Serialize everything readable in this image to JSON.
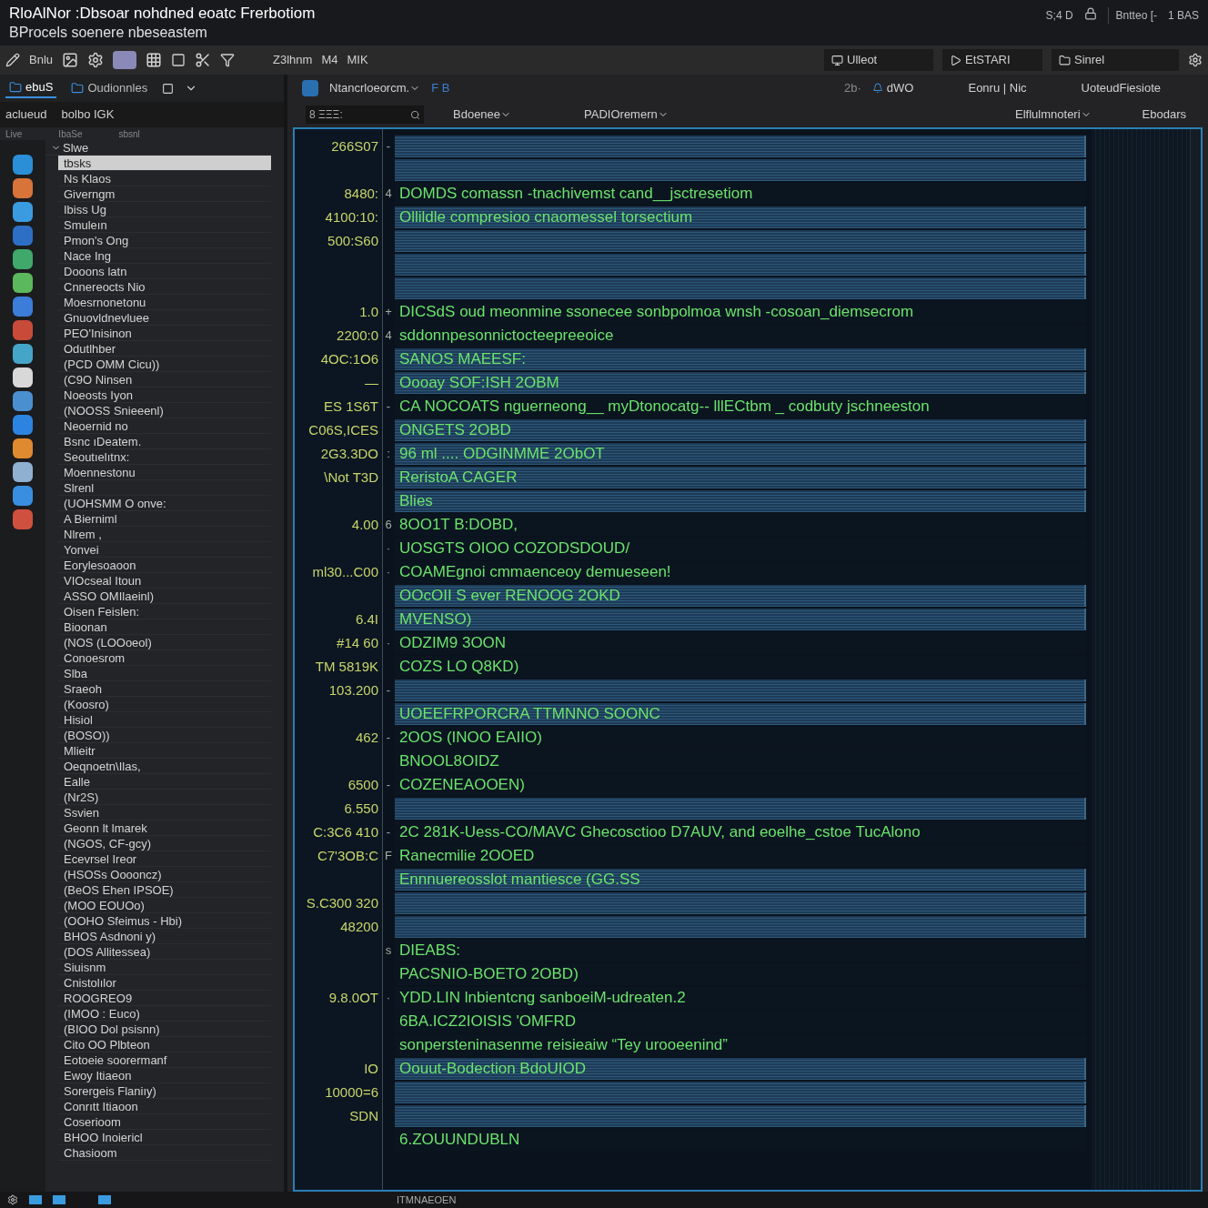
{
  "window": {
    "title": "RloAlNor :Dbsoar nohdned eoatc Frerbotiom",
    "subtitle": "BProcels soenere nbeseastem",
    "status": [
      "S;4 D",
      "Bntteo [-",
      "1 BAS"
    ]
  },
  "toolbar": {
    "labels": [
      "Bnlu",
      "Z3lhnm",
      "M4",
      "MIK"
    ],
    "right": [
      "Ulleot",
      "EtSTARI",
      "Sinrel"
    ]
  },
  "sidebar": {
    "tabs": [
      {
        "label": "ebuS",
        "selected": true
      },
      {
        "label": "Oudionnles",
        "selected": false
      }
    ],
    "filters": [
      "aclueud",
      "bolbo IGK"
    ],
    "columns": [
      "Live",
      "IbaSe",
      "sbsnl"
    ],
    "tree": [
      {
        "label": "Slwe",
        "expanded": true,
        "selected": false,
        "children": [
          {
            "label": "tbsks",
            "selected": true
          },
          {
            "label": "Ns Klaos",
            "selected": false
          },
          {
            "label": "Giverngm",
            "selected": false
          },
          {
            "label": "Ibiss Ug",
            "selected": false
          },
          {
            "label": "Smuleın",
            "selected": false
          },
          {
            "label": "Pmon's Ong",
            "selected": false
          },
          {
            "label": "Nace Ing",
            "selected": false
          },
          {
            "label": "Dooons latn",
            "selected": false
          },
          {
            "label": "Cnnereocts Nio",
            "selected": false
          },
          {
            "label": "Moesrnonetonu",
            "selected": false
          },
          {
            "label": "Gnuovldnevluee",
            "selected": false
          },
          {
            "label": "PEO'Inisinon",
            "selected": false
          },
          {
            "label": "Odutlhber",
            "selected": false
          },
          {
            "label": "(PCD OMM Cicu))",
            "selected": false
          },
          {
            "label": "(C9O Ninsen",
            "selected": false
          },
          {
            "label": "Noeosts Iyon",
            "selected": false
          },
          {
            "label": "(NOOSS Snieeenl)",
            "selected": false
          },
          {
            "label": "Neoernid no",
            "selected": false
          },
          {
            "label": "Bsnc ıDeatem.",
            "selected": false
          },
          {
            "label": "Seoutıelıtnx:",
            "selected": false
          },
          {
            "label": "Moennestonu",
            "selected": false
          },
          {
            "label": "Slrenl",
            "selected": false
          },
          {
            "label": "(UOHSMM O onve:",
            "selected": false
          },
          {
            "label": "A Bierniml",
            "selected": false
          },
          {
            "label": "Nlrem ,",
            "selected": false
          },
          {
            "label": "Yonvei",
            "selected": false
          },
          {
            "label": "Eorylesoaoon",
            "selected": false
          },
          {
            "label": "VIOcseal Itoun",
            "selected": false
          },
          {
            "label": "ASSO OMIlaeinl)",
            "selected": false
          },
          {
            "label": "Oisen Feislen:",
            "selected": false
          },
          {
            "label": "Bioonan",
            "selected": false
          },
          {
            "label": "(NOS (LOOoeol)",
            "selected": false
          },
          {
            "label": "Conoesrom",
            "selected": false
          },
          {
            "label": "Slba",
            "selected": false
          },
          {
            "label": "Sraeoh",
            "selected": false
          },
          {
            "label": "(Koosro)",
            "selected": false
          },
          {
            "label": "Hisiol",
            "selected": false
          },
          {
            "label": "(BOSO))",
            "selected": false
          },
          {
            "label": "Mlieitr",
            "selected": false
          },
          {
            "label": "Oeqnoetn\\Ilas,",
            "selected": false
          },
          {
            "label": "Ealle",
            "selected": false
          },
          {
            "label": "(Nr2S)",
            "selected": false
          },
          {
            "label": "Ssvien",
            "selected": false
          },
          {
            "label": "Geonn lt lmarek",
            "selected": false
          },
          {
            "label": "(NGOS, CF-gcy)",
            "selected": false
          },
          {
            "label": "Ecevrsel Ireor",
            "selected": false
          },
          {
            "label": "(HSOSs Ooooncz)",
            "selected": false
          },
          {
            "label": "(BeOS Ehen IPSOE)",
            "selected": false
          },
          {
            "label": "(MOO EOUOo)",
            "selected": false
          },
          {
            "label": "(OOHO Sfeimus - Hbi)",
            "selected": false
          },
          {
            "label": "BHOS Asdnoni y)",
            "selected": false
          },
          {
            "label": "(DOS Allitessea)",
            "selected": false
          },
          {
            "label": "Siuisnm",
            "selected": false
          },
          {
            "label": "Cnistolılor",
            "selected": false
          },
          {
            "label": "ROOGREO9",
            "selected": false
          },
          {
            "label": "(IMOO : Euco)",
            "selected": false
          },
          {
            "label": "(BIOO Dol psisnn)",
            "selected": false
          },
          {
            "label": "Cito OO Plbteon",
            "selected": false
          },
          {
            "label": "Eotoeie soorermanf",
            "selected": false
          },
          {
            "label": "Ewoy Itiaeon",
            "selected": false
          },
          {
            "label": "Sorergeis Flaniıy)",
            "selected": false
          },
          {
            "label": "Conrıtt Itiaoon",
            "selected": false
          },
          {
            "label": "Coserioom",
            "selected": false
          },
          {
            "label": "BHOO Inoiericl",
            "selected": false
          },
          {
            "label": "Chasioom",
            "selected": false
          }
        ]
      }
    ]
  },
  "main": {
    "source": "Ntancrloeorcm.",
    "source_tag": "F B",
    "right_items": [
      "2b·",
      "dWO",
      "Eonru | Nic",
      "UoteudFiesiote"
    ],
    "search": {
      "value": "8 ΞΞΞ:"
    },
    "filters": [
      "Bdoenee",
      "PADIOremern"
    ],
    "right_filters": [
      "Elflulmnoteri",
      "Ebodars"
    ]
  },
  "log": {
    "rows": [
      {
        "kind": "band",
        "number": "266S07",
        "marker": "-"
      },
      {
        "kind": "band"
      },
      {
        "kind": "line",
        "number": "8480:",
        "marker": "4",
        "text": "DOMDS comassn -tnachivemst cand__jsctresetiom"
      },
      {
        "kind": "band",
        "number": "4100:10:",
        "text": "Ollildle compresioo cnaomessel torsectium"
      },
      {
        "kind": "band",
        "number": "500:S60"
      },
      {
        "kind": "band"
      },
      {
        "kind": "band"
      },
      {
        "kind": "line",
        "number": "1.0",
        "marker": "+",
        "text": "DICSdS oud meonmine ssonecee  sonbpolmoa wnsh -cosoan_diemsecrom"
      },
      {
        "kind": "line",
        "number": "2200:0",
        "marker": "4",
        "text": "sddonnpesonnictocteepreeoice"
      },
      {
        "kind": "band",
        "number": "4OC:1O6",
        "text": "SANOS MAEESF:"
      },
      {
        "kind": "band",
        "number": "—",
        "text": "Oooay SOF:ISH 2OBM"
      },
      {
        "kind": "line",
        "number": "ES 1S6T",
        "marker": "-",
        "text": "CA NOCOATS nguerneong__ myDtonocatg-- lllECtbm _ codbuty jschneeston"
      },
      {
        "kind": "band",
        "number": "C06S,ICES",
        "text": "ONGETS 2OBD"
      },
      {
        "kind": "band",
        "number": "2G3.3DO",
        "marker": ":",
        "text": "96 ml .... ODGINMME 2ObOT"
      },
      {
        "kind": "band",
        "number": "\\Not T3D",
        "text": "ReristoA CAGER"
      },
      {
        "kind": "band",
        "text": "Blies"
      },
      {
        "kind": "line",
        "number": "4.00",
        "marker": "6",
        "text": "8OO1T B:DOBD,"
      },
      {
        "kind": "line",
        "marker": "·",
        "text": "UOSGTS OIOO COZODSDOUD/"
      },
      {
        "kind": "line",
        "number": "ml30...C00",
        "marker": "·",
        "text": "COAMEgnoi cmmaenceoy demueseen!"
      },
      {
        "kind": "band",
        "text": "OOcOII S ever RENOOG 2OKD"
      },
      {
        "kind": "band",
        "number": "6.4I",
        "text": "MVENSO)"
      },
      {
        "kind": "line",
        "number": "#14 60",
        "marker": "·",
        "text": "ODZIM9 3OON"
      },
      {
        "kind": "line",
        "number": "TM 5819K",
        "text": "COZS LO Q8KD)"
      },
      {
        "kind": "band",
        "number": "103.200",
        "marker": "-"
      },
      {
        "kind": "band",
        "text": "UOEEFRPORCRA TTMNNO SOONC"
      },
      {
        "kind": "line",
        "number": "462",
        "marker": "-",
        "text": "2OOS (INOO EAIIO)"
      },
      {
        "kind": "line",
        "text": "BNOOL8OIDZ"
      },
      {
        "kind": "line",
        "number": "6500",
        "marker": "-",
        "text": "COZENEAOOEN)"
      },
      {
        "kind": "band",
        "number": "6.550"
      },
      {
        "kind": "line",
        "number": "C:3C6 410",
        "marker": "-",
        "text": "2C 281K-Uess-CO/MAVC Ghecosctioo D7AUV, and eoelhe_cstoe TucAlono"
      },
      {
        "kind": "line",
        "number": "C7'3OB:C",
        "marker": "F",
        "text": "Ranecmilie 2OOED"
      },
      {
        "kind": "band",
        "text": "Ennnuereosslot mantiesce (GG.SS"
      },
      {
        "kind": "band",
        "number": "S.C300 320"
      },
      {
        "kind": "band",
        "number": "48200"
      },
      {
        "kind": "line",
        "marker": "s",
        "text": "DIEABS:"
      },
      {
        "kind": "line",
        "text": "PACSNIO-BOETO 2OBD)"
      },
      {
        "kind": "line",
        "number": "9.8.0OT",
        "marker": "·",
        "text": "YDD.LIN lnbientcng sanboeiM-udreaten.2"
      },
      {
        "kind": "line",
        "text": "6BA.ICZ2IOISIS 'OMFRD"
      },
      {
        "kind": "line",
        "text": "sonpersteninasenme reisieaiw “Tey urooeenind”"
      },
      {
        "kind": "band",
        "number": "IO",
        "text": "Oouut-Bodection BdoUIOD"
      },
      {
        "kind": "band",
        "number": "10000=6"
      },
      {
        "kind": "band",
        "number": "SDN"
      },
      {
        "kind": "line",
        "text": "6.ZOUUNDUBLN"
      }
    ]
  },
  "status_bar": {
    "text": "ITMNAEOEN"
  }
}
